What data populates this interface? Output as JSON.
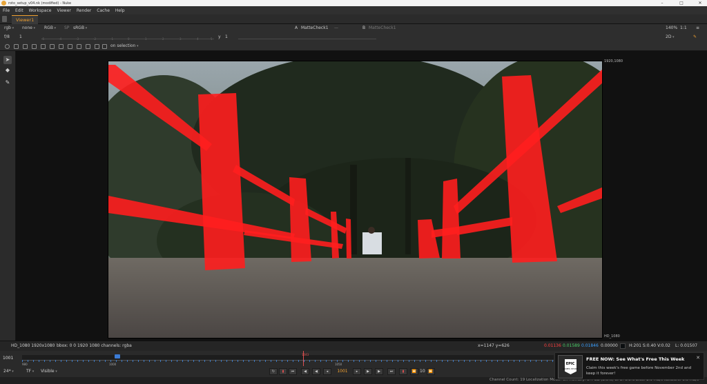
{
  "window": {
    "title": "roto_setup_v04.nk (modified) - Nuke",
    "controls": {
      "minimize": "–",
      "maximize": "□",
      "close": "✕"
    }
  },
  "menu": [
    "File",
    "Edit",
    "Workspace",
    "Viewer",
    "Render",
    "Cache",
    "Help"
  ],
  "tab": {
    "label": "Viewer1"
  },
  "viewer_toolbar": {
    "channels": "rgb",
    "alpha": "none",
    "display": "RGB",
    "lut_icon": "SP",
    "colorspace": "sRGB",
    "input_a": "A",
    "input_a_node": "MatteCheck1",
    "input_b": "B",
    "input_b_node": "MatteCheck1",
    "zoom": "140%",
    "ratio": "1:1",
    "view_mode": "2D"
  },
  "gain_bar": {
    "fstop_label": "f/8",
    "gain_value": "1",
    "gamma_label": "y",
    "gamma_value": "1",
    "ticks": [
      "-5",
      "-4",
      "-3",
      "-2",
      "-1",
      "0",
      "1",
      "2",
      "3",
      "4",
      "5"
    ]
  },
  "roto_toolbar": {
    "on_selection": "on selection"
  },
  "format_labels": {
    "top_right": "1920,1080",
    "bottom_right": "HD_1080"
  },
  "info": {
    "format": "HD_1080 1920x1080",
    "bbox": "bbox: 0 0 1920 1080 channels: rgba",
    "coords": "x=1147 y=626",
    "r": "0.01136",
    "g": "0.01589",
    "b": "0.01846",
    "a": "0.00000",
    "hsv": "H:201 S:0.40 V:0.02",
    "l": "L: 0.01507"
  },
  "timeline": {
    "frame": "1001",
    "start": "980",
    "in_point": "1000",
    "mid": "1050",
    "playhead_label": "1043"
  },
  "playback": {
    "fps": "24*",
    "tf": "TF",
    "visible": "Visible",
    "current_frame": "1001",
    "skip_count": "10"
  },
  "status": "Channel Count: 19  Localization Mode: On  Memory: 3.4 GB (8.5%)  CPU: 0.0%  Disk: 2.9 MB/s  Network: 0.0 MB/s",
  "notification": {
    "logo_text": "EPIC",
    "logo_sub": "GAMES STORE",
    "headline": "FREE NOW: See What's Free This Week",
    "body": "Claim this week's free game before November 2nd and keep it forever!",
    "close": "✕"
  },
  "colors": {
    "accent": "#f0a030",
    "matte": "#ff1e1e",
    "timeline_blue": "#3b7bd5"
  }
}
